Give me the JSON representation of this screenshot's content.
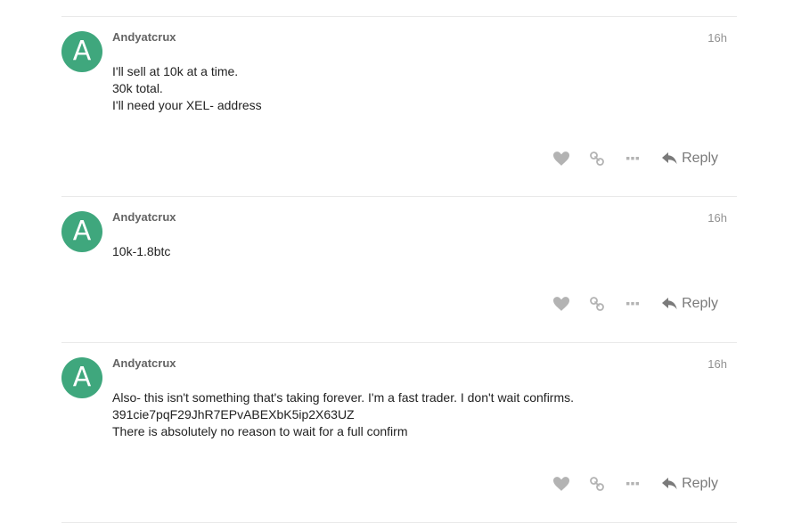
{
  "colors": {
    "avatar_bg": "#3fa77d",
    "muted": "#919191",
    "divider": "#e9e9e9"
  },
  "icons": [
    "heart-icon",
    "link-icon",
    "more-icon",
    "reply-icon"
  ],
  "posts": [
    {
      "avatar_letter": "A",
      "username": "Andyatcrux",
      "date": "16h",
      "lines": [
        "I'll sell at 10k at a time.",
        "30k total.",
        "I'll need your XEL- address"
      ],
      "reply_label": "Reply"
    },
    {
      "avatar_letter": "A",
      "username": "Andyatcrux",
      "date": "16h",
      "lines": [
        "10k-1.8btc"
      ],
      "reply_label": "Reply"
    },
    {
      "avatar_letter": "A",
      "username": "Andyatcrux",
      "date": "16h",
      "lines": [
        "Also- this isn't something that's taking forever. I'm a fast trader. I don't wait confirms.",
        "391cie7pqF29JhR7EPvABEXbK5ip2X63UZ",
        "There is absolutely no reason to wait for a full confirm"
      ],
      "reply_label": "Reply"
    }
  ]
}
